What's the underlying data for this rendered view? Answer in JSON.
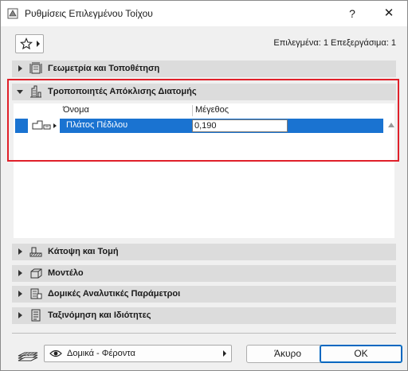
{
  "window": {
    "title": "Ρυθμίσεις Επιλεγμένου Τοίχου",
    "help_label": "?",
    "close_label": "✕"
  },
  "toolbar": {
    "favorites_icon": "star-icon",
    "selection_info": "Επιλεγμένα: 1 Επεξεργάσιμα: 1"
  },
  "sections": [
    {
      "label": "Γεωμετρία και Τοποθέτηση",
      "icon": "geometry-icon",
      "expanded": false
    },
    {
      "label": "Τροποποιητές Απόκλισης Διατομής",
      "icon": "profile-modifier-icon",
      "expanded": true
    },
    {
      "label": "Κάτοψη και Τομή",
      "icon": "floor-plan-icon",
      "expanded": false
    },
    {
      "label": "Μοντέλο",
      "icon": "model-icon",
      "expanded": false
    },
    {
      "label": "Δομικές Αναλυτικές Παράμετροι",
      "icon": "structural-icon",
      "expanded": false
    },
    {
      "label": "Ταξινόμηση και Ιδιότητες",
      "icon": "classification-icon",
      "expanded": false
    }
  ],
  "table": {
    "columns": [
      "Όνομα",
      "Μέγεθος"
    ],
    "rows": [
      {
        "name": "Πλάτος Πέδιλου",
        "value": "0,190"
      }
    ]
  },
  "footer": {
    "layer_dropdown": "Δομικά - Φέροντα",
    "cancel_label": "Άκυρο",
    "ok_label": "OK"
  },
  "colors": {
    "selection": "#1a73d1",
    "highlight_box": "#e0202a",
    "section_bg": "#dcdcdc"
  }
}
